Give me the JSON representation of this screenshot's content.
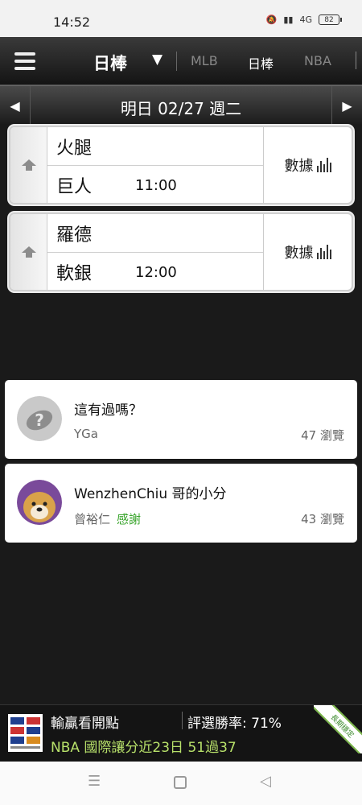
{
  "status_bar": {
    "time": "14:52",
    "battery": "82",
    "network": "4G"
  },
  "top_nav": {
    "current_league": "日棒",
    "tabs": [
      "MLB",
      "日棒",
      "NBA"
    ]
  },
  "date_bar": {
    "label": "明日 02/27 週二"
  },
  "games": [
    {
      "team_top": "火腿",
      "team_bottom": "巨人",
      "time": "11:00",
      "stats_label": "數據"
    },
    {
      "team_top": "羅德",
      "team_bottom": "軟銀",
      "time": "12:00",
      "stats_label": "數據"
    }
  ],
  "posts": [
    {
      "title": "這有過嗎？",
      "author": "YGa",
      "thanks": "",
      "views": "47 瀏覽"
    },
    {
      "title": "WenzhenChiu 哥的小分",
      "author": "曾裕仁",
      "thanks": "感謝",
      "views": "43 瀏覽"
    }
  ],
  "banner": {
    "title": "輸贏看開點",
    "winrate": "評選勝率: 71%",
    "pick": "NBA 國際讓分近23日 51過37",
    "ribbon": "長期穩定"
  },
  "colors": {
    "accent_green": "#3aa52d",
    "banner_text": "#b7e06a"
  }
}
